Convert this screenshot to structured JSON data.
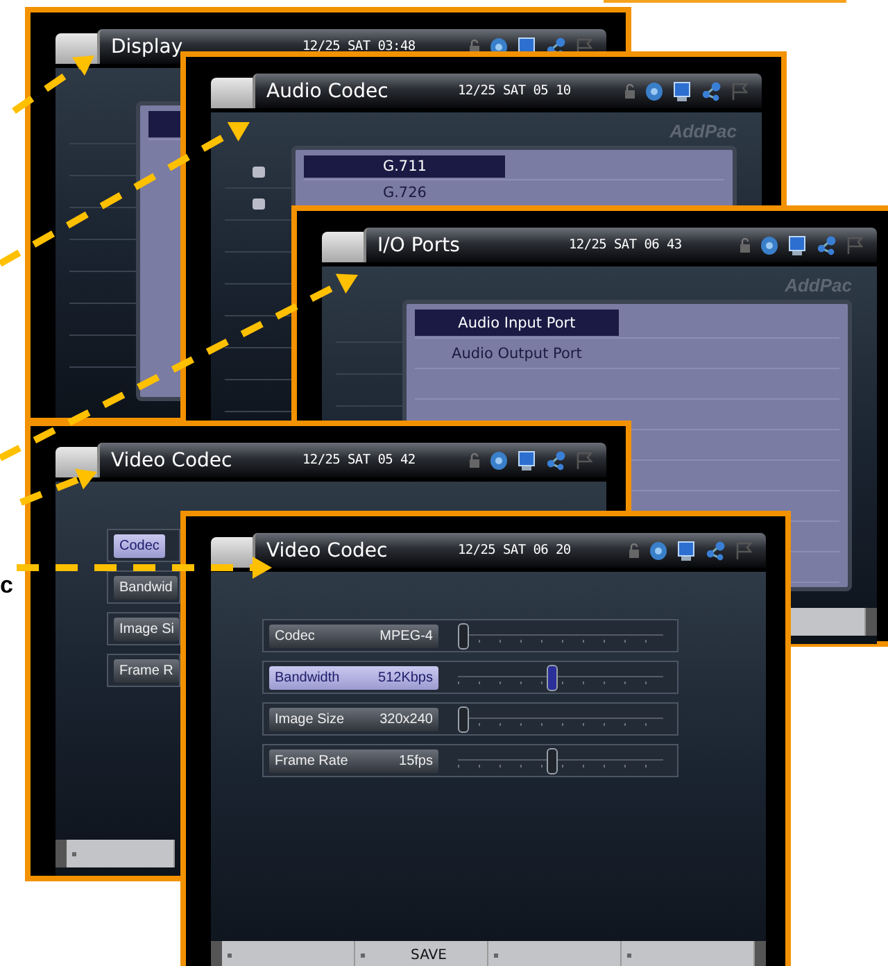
{
  "edge_label": "c",
  "windows": [
    {
      "kind": "blank",
      "title": "Display",
      "time": "12/25 SAT 03:48"
    },
    {
      "kind": "list",
      "title": "Audio Codec",
      "time": "12/25 SAT 05 10",
      "logo": "AddPac",
      "bullets": true,
      "items": [
        {
          "label": "G.711",
          "selected": true
        },
        {
          "label": "G.726",
          "selected": false
        }
      ]
    },
    {
      "kind": "list",
      "title": "I/O Ports",
      "time": "12/25 SAT 06 43",
      "logo": "AddPac",
      "bullets": false,
      "items": [
        {
          "label": "Audio Input Port",
          "selected": true
        },
        {
          "label": "Audio Output Port",
          "selected": false
        }
      ],
      "footer": [
        {
          "kind": "end"
        }
      ]
    },
    {
      "kind": "settings",
      "title": "Video Codec",
      "time": "12/25 SAT 05 42",
      "settings": [
        {
          "label": "Codec",
          "selected": true
        },
        {
          "label": "Bandwid",
          "selected": false
        },
        {
          "label": "Image Si",
          "selected": false
        },
        {
          "label": "Frame R",
          "selected": false
        }
      ],
      "footer": [
        {
          "kind": "blank"
        }
      ]
    },
    {
      "kind": "settings",
      "title": "Video Codec",
      "time": "12/25 SAT 06 20",
      "settings": [
        {
          "label": "Codec",
          "value": "MPEG-4",
          "selected": false,
          "level": 0.02
        },
        {
          "label": "Bandwidth",
          "value": "512Kbps",
          "selected": true,
          "level": 0.45
        },
        {
          "label": "Image Size",
          "value": "320x240",
          "selected": false,
          "level": 0.02
        },
        {
          "label": "Frame Rate",
          "value": "15fps",
          "selected": false,
          "level": 0.45
        }
      ],
      "footer": [
        {
          "kind": "blank"
        },
        {
          "kind": "button",
          "label": "SAVE"
        },
        {
          "kind": "blank"
        },
        {
          "kind": "blank"
        }
      ]
    }
  ]
}
